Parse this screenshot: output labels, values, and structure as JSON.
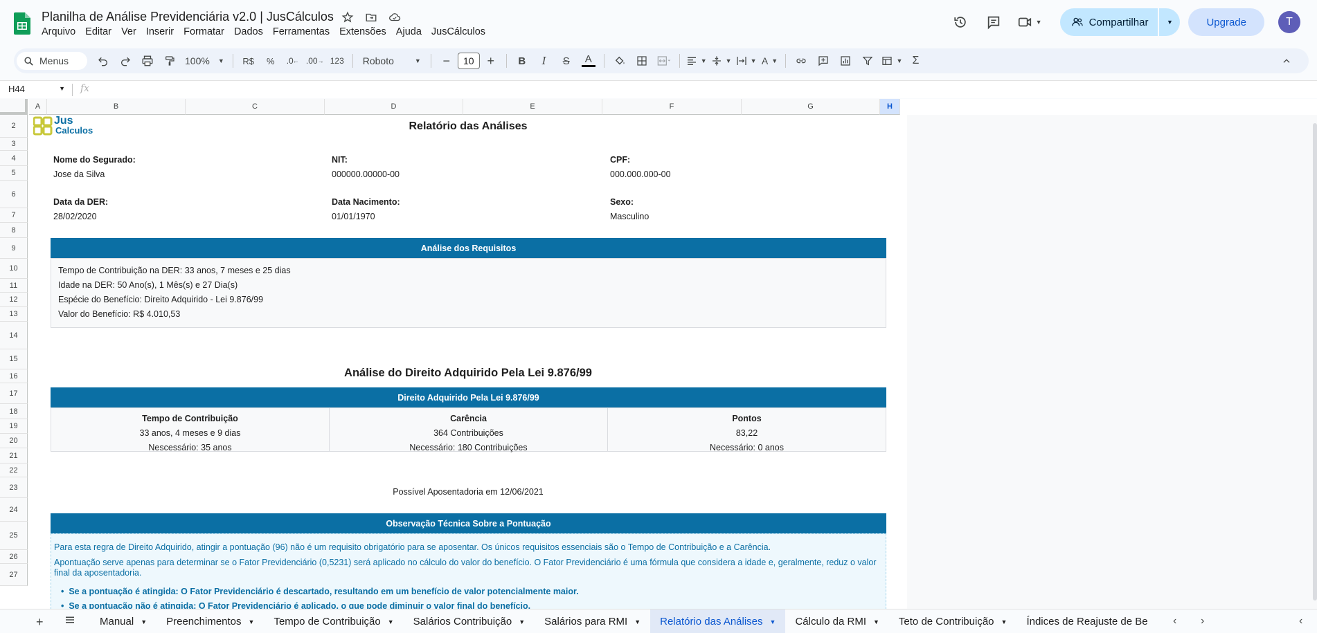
{
  "app": {
    "title": "Planilha de Análise Previdenciária v2.0 | JusCálculos",
    "menu": [
      "Arquivo",
      "Editar",
      "Ver",
      "Inserir",
      "Formatar",
      "Dados",
      "Ferramentas",
      "Extensões",
      "Ajuda",
      "JusCálculos"
    ],
    "share_label": "Compartilhar",
    "upgrade_label": "Upgrade",
    "avatar_letter": "T"
  },
  "toolbar": {
    "search_label": "Menus",
    "zoom": "100%",
    "currency": "R$",
    "percent": "%",
    "dec_less": ".0",
    "dec_more": ".00",
    "format_123": "123",
    "font": "Roboto",
    "font_size": "10"
  },
  "formula": {
    "cell_ref": "H44",
    "fx": "fx"
  },
  "grid": {
    "columns": [
      {
        "label": "A",
        "width": 26
      },
      {
        "label": "B",
        "width": 200
      },
      {
        "label": "C",
        "width": 201
      },
      {
        "label": "D",
        "width": 200
      },
      {
        "label": "E",
        "width": 201
      },
      {
        "label": "F",
        "width": 201
      },
      {
        "label": "G",
        "width": 200
      },
      {
        "label": "H",
        "width": 29
      }
    ],
    "rows": [
      {
        "n": "2",
        "h": 33
      },
      {
        "n": "3",
        "h": 19
      },
      {
        "n": "4",
        "h": 22
      },
      {
        "n": "5",
        "h": 21
      },
      {
        "n": "6",
        "h": 40
      },
      {
        "n": "7",
        "h": 21
      },
      {
        "n": "8",
        "h": 22
      },
      {
        "n": "9",
        "h": 30
      },
      {
        "n": "10",
        "h": 29
      },
      {
        "n": "11",
        "h": 20
      },
      {
        "n": "12",
        "h": 21
      },
      {
        "n": "13",
        "h": 21
      },
      {
        "n": "14",
        "h": 40
      },
      {
        "n": "15",
        "h": 29
      },
      {
        "n": "16",
        "h": 20
      },
      {
        "n": "17",
        "h": 30
      },
      {
        "n": "18",
        "h": 22
      },
      {
        "n": "19",
        "h": 21
      },
      {
        "n": "20",
        "h": 21
      },
      {
        "n": "21",
        "h": 22
      },
      {
        "n": "22",
        "h": 20
      },
      {
        "n": "23",
        "h": 30
      },
      {
        "n": "24",
        "h": 34
      },
      {
        "n": "25",
        "h": 41
      },
      {
        "n": "26",
        "h": 20
      },
      {
        "n": "27",
        "h": 32
      }
    ]
  },
  "report": {
    "logo_jus": "Jus",
    "logo_calculos": "Calculos",
    "title": "Relatório das Análises",
    "nome_label": "Nome do Segurado:",
    "nome_value": "Jose da Silva",
    "nit_label": "NIT:",
    "nit_value": "000000.00000-00",
    "cpf_label": "CPF:",
    "cpf_value": "000.000.000-00",
    "der_label": "Data da DER:",
    "der_value": "28/02/2020",
    "nasc_label": "Data Nacimento:",
    "nasc_value": "01/01/1970",
    "sexo_label": "Sexo:",
    "sexo_value": "Masculino",
    "requisitos_header": "Análise dos Requisitos",
    "requisitos_lines": [
      "Tempo de Contribuição na DER: 33 anos, 7 meses e 25 dias",
      "Idade na DER: 50 Ano(s), 1 Mês(s) e 27 Dia(s)",
      "Espécie do Benefício: Direito Adquirido - Lei 9.876/99",
      "Valor do Benefício: R$ 4.010,53"
    ],
    "section_title": "Análise do Direito Adquirido Pela Lei 9.876/99",
    "direito_header": "Direito Adquirido Pela Lei 9.876/99",
    "metrics": [
      {
        "title": "Tempo de Contribuição",
        "value": "33 anos, 4 meses e 9 dias",
        "need": "Nescessário: 35 anos"
      },
      {
        "title": "Carência",
        "value": "364 Contribuições",
        "need": "Necessário: 180 Contribuições"
      },
      {
        "title": "Pontos",
        "value": "83,22",
        "need": "Necessário: 0 anos"
      }
    ],
    "possivel": "Possível Aposentadoria em 12/06/2021",
    "obs_header": "Observação Técnica Sobre a Pontuação",
    "obs_p1": "Para esta regra de Direito Adquirido, atingir a pontuação (96) não é um requisito obrigatório para se aposentar. Os únicos requisitos essenciais são o Tempo de Contribuição e a Carência.",
    "obs_p2": "  Apontuação serve apenas para determinar se o Fator Previdenciário (0,5231) será aplicado no cálculo do valor do benefício. O Fator Previdenciário é uma fórmula que considera a idade e, geralmente, reduz o valor final da aposentadoria.",
    "obs_b1": "Se a pontuação é atingida: O Fator Previdenciário é descartado, resultando em um benefício de valor potencialmente maior.",
    "obs_b2": "Se a pontuação não é atingida: O Fator Previdenciário é aplicado, o que pode diminuir o valor final do benefício."
  },
  "tabs": [
    {
      "label": "Manual",
      "active": false
    },
    {
      "label": "Preenchimentos",
      "active": false
    },
    {
      "label": "Tempo de Contribuição",
      "active": false
    },
    {
      "label": "Salários Contribuição",
      "active": false
    },
    {
      "label": "Salários para RMI",
      "active": false
    },
    {
      "label": "Relatório das Análises",
      "active": true
    },
    {
      "label": "Cálculo da RMI",
      "active": false
    },
    {
      "label": "Teto de Contribuição",
      "active": false
    },
    {
      "label": "Índices de Reajuste de Be",
      "active": false
    }
  ],
  "colors": {
    "header_blue": "#0b6fa4",
    "share_bg": "#c2e7ff",
    "sheets_green": "#0f9d58",
    "logo_yellow": "#c8c83a"
  }
}
